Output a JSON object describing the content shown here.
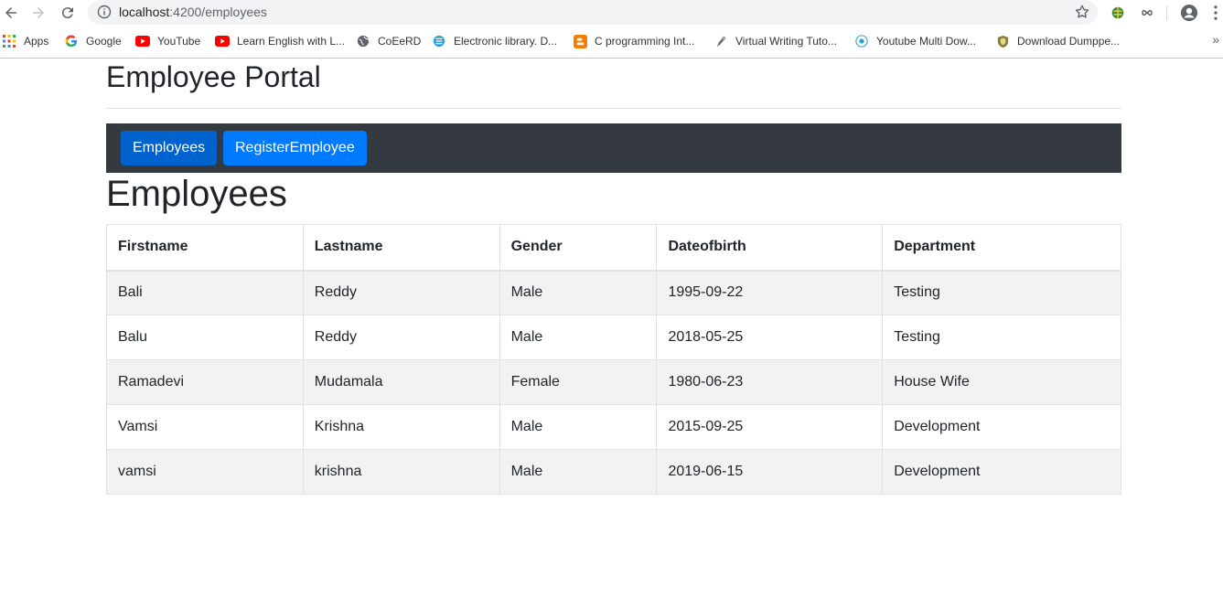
{
  "browser": {
    "url_host": "localhost",
    "url_path": ":4200/employees",
    "bookmarks": [
      {
        "label": "Apps",
        "icon": "apps-grid-icon"
      },
      {
        "label": "Google",
        "icon": "google-icon"
      },
      {
        "label": "YouTube",
        "icon": "youtube-icon"
      },
      {
        "label": "Learn English with L...",
        "icon": "youtube-icon"
      },
      {
        "label": "CoEeRD",
        "icon": "globe-icon"
      },
      {
        "label": "Electronic library. D...",
        "icon": "library-icon"
      },
      {
        "label": "C programming Int...",
        "icon": "blogger-icon"
      },
      {
        "label": "Virtual Writing Tuto...",
        "icon": "writing-icon"
      },
      {
        "label": "Youtube Multi Dow...",
        "icon": "download-icon"
      },
      {
        "label": "Download Dumppe...",
        "icon": "shield-icon"
      }
    ]
  },
  "page": {
    "portal_title": "Employee Portal",
    "nav": {
      "employees_label": "Employees",
      "register_label": "RegisterEmployee"
    },
    "heading": "Employees"
  },
  "table": {
    "headers": [
      "Firstname",
      "Lastname",
      "Gender",
      "Dateofbirth",
      "Department"
    ],
    "rows": [
      [
        "Bali",
        "Reddy",
        "Male",
        "1995-09-22",
        "Testing"
      ],
      [
        "Balu",
        "Reddy",
        "Male",
        "2018-05-25",
        "Testing"
      ],
      [
        "Ramadevi",
        "Mudamala",
        "Female",
        "1980-06-23",
        "House Wife"
      ],
      [
        "Vamsi",
        "Krishna",
        "Male",
        "2015-09-25",
        "Development"
      ],
      [
        "vamsi",
        "krishna",
        "Male",
        "2019-06-15",
        "Development"
      ]
    ]
  },
  "colors": {
    "primary": "#007bff",
    "primary_active": "#0062cc",
    "navbar": "#343a40",
    "striped_row": "#f2f2f2"
  }
}
